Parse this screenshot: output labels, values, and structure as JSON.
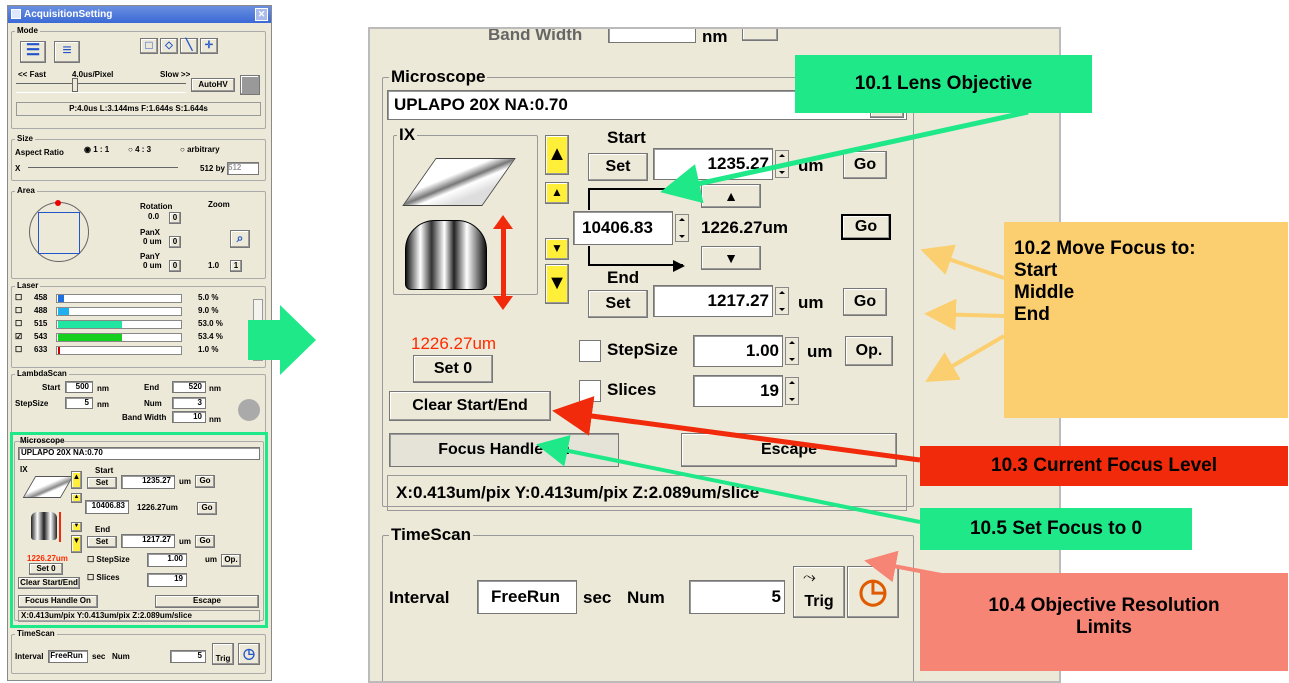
{
  "left_panel": {
    "title": "AcquisitionSetting",
    "mode_label": "Mode",
    "fast": "<< Fast",
    "pixel_time": "4.0us/Pixel",
    "slow": "Slow >>",
    "autohv": "AutoHV",
    "timing": "P:4.0us  L:3.144ms  F:1.644s  S:1.644s",
    "size_label": "Size",
    "aspect_ratio": "Aspect Ratio",
    "ratio_11": "1 : 1",
    "ratio_43": "4 : 3",
    "ratio_arb": "arbitrary",
    "size_x": "X",
    "size_by": "512 by",
    "size_val": "512",
    "area_label": "Area",
    "rotation": "Rotation",
    "rotation_val": "0.0",
    "zoom": "Zoom",
    "panx": "PanX",
    "panx_val": "0 um",
    "pany": "PanY",
    "pany_val": "0 um",
    "zoom_val": "1.0",
    "zero": "0",
    "one": "1",
    "laser_label": "Laser",
    "lasers": [
      {
        "wl": "458",
        "pct": "5.0 %",
        "level": 0.05,
        "color": "#1f6fe0",
        "checked": false
      },
      {
        "wl": "488",
        "pct": "9.0 %",
        "level": 0.09,
        "color": "#1fb0f0",
        "checked": false
      },
      {
        "wl": "515",
        "pct": "53.0 %",
        "level": 0.53,
        "color": "#21e6a2",
        "checked": false
      },
      {
        "wl": "543",
        "pct": "53.4 %",
        "level": 0.534,
        "color": "#16d020",
        "checked": true
      },
      {
        "wl": "633",
        "pct": "1.0 %",
        "level": 0.01,
        "color": "#d00000",
        "checked": false
      }
    ],
    "lambda_label": "LambdaScan",
    "start": "Start",
    "start_val": "500",
    "nm": "nm",
    "end": "End",
    "end_val": "520",
    "stepsize": "StepSize",
    "step_val": "5",
    "num": "Num",
    "num_val": "3",
    "bandwidth": "Band Width",
    "bw_val": "10",
    "timescan_label": "TimeScan",
    "interval": "Interval",
    "freerun": "FreeRun",
    "sec": "sec",
    "ts_num": "Num",
    "ts_num_val": "5",
    "trig": "Trig"
  },
  "microscope": {
    "label": "Microscope",
    "objective": "UPLAPO   20X  NA:0.70",
    "ix": "IX",
    "start": "Start",
    "set": "Set",
    "start_val": "1235.27",
    "um": "um",
    "go": "Go",
    "middle_val": "10406.83",
    "current_mid": "1226.27um",
    "end": "End",
    "end_val": "1217.27",
    "current_focus": "1226.27um",
    "set0": "Set 0",
    "stepsize": "StepSize",
    "step_val": "1.00",
    "op": "Op.",
    "slices": "Slices",
    "slices_val": "19",
    "clear": "Clear Start/End",
    "focus_handle": "Focus Handle On",
    "escape": "Escape",
    "resolution": "X:0.413um/pix Y:0.413um/pix Z:2.089um/slice",
    "bandwidth_cut": "Band Width",
    "bw_unit": "nm"
  },
  "timescan": {
    "label": "TimeScan",
    "interval": "Interval",
    "freerun": "FreeRun",
    "sec": "sec",
    "num": "Num",
    "num_val": "5",
    "trig": "Trig"
  },
  "callouts": {
    "lens": "10.1 Lens Objective",
    "move_title": "10.2 Move Focus to:",
    "move_start": "Start",
    "move_middle": "Middle",
    "move_end": "End",
    "current": "10.3 Current Focus Level",
    "resolution_title": "10.4 Objective Resolution",
    "resolution_sub": "Limits",
    "set0": "10.5 Set Focus to 0"
  },
  "colors": {
    "green": "#1fe889",
    "orange": "#fbcf6f",
    "red": "#f02a0a",
    "salmon": "#f78576",
    "focus_red": "#ff2a00"
  }
}
